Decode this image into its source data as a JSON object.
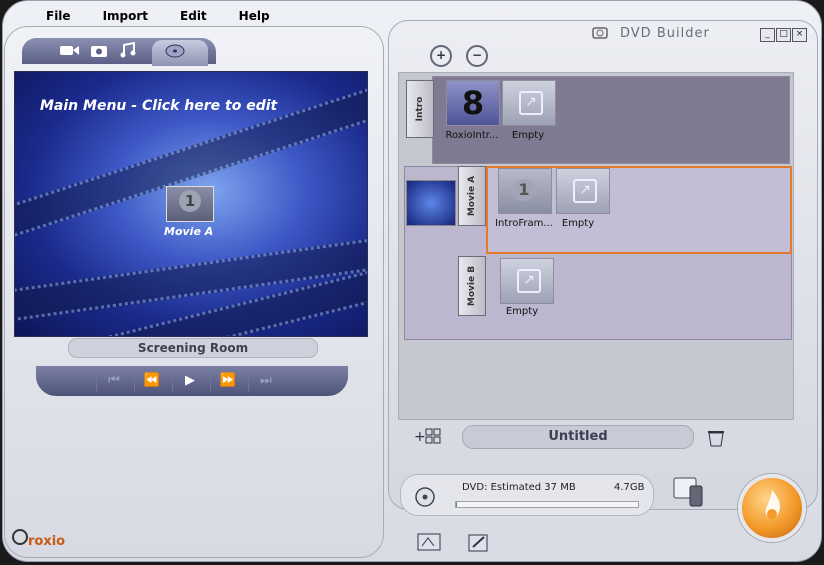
{
  "menu": {
    "items": [
      "File",
      "Import",
      "Edit",
      "Help"
    ]
  },
  "window": {
    "title": "DVD Builder",
    "minimize": "_",
    "maximize": "□",
    "close": "×"
  },
  "tabs": {
    "icons": [
      "video-camera-icon",
      "camera-icon",
      "music-icon",
      "dvd-icon"
    ]
  },
  "preview": {
    "menu_title": "Main Menu - Click here to edit",
    "thumb_number": "1",
    "thumb_label": "Movie A",
    "screen_label": "Screening Room"
  },
  "transport": {
    "buttons": [
      "⏮",
      "⏪",
      "▶",
      "⏩",
      "⏭"
    ]
  },
  "brand": {
    "name": "roxio"
  },
  "tracks": {
    "intro": {
      "tab": "Intro",
      "slots": [
        {
          "label": "RoxioIntr...",
          "badge": "8"
        },
        {
          "label": "Empty"
        }
      ]
    },
    "movie_a": {
      "tab": "Movie A",
      "slots": [
        {
          "label": "IntroFram...",
          "badge": "1"
        },
        {
          "label": "Empty"
        }
      ]
    },
    "movie_b": {
      "tab": "Movie B",
      "slots": [
        {
          "label": "Empty"
        }
      ]
    }
  },
  "project": {
    "name": "Untitled"
  },
  "dvd": {
    "estimate": "DVD: Estimated 37 MB",
    "capacity": "4.7GB",
    "usage_fraction": 0.008
  },
  "colors": {
    "accent": "#e57a2e",
    "panel": "#bdb6cf"
  }
}
